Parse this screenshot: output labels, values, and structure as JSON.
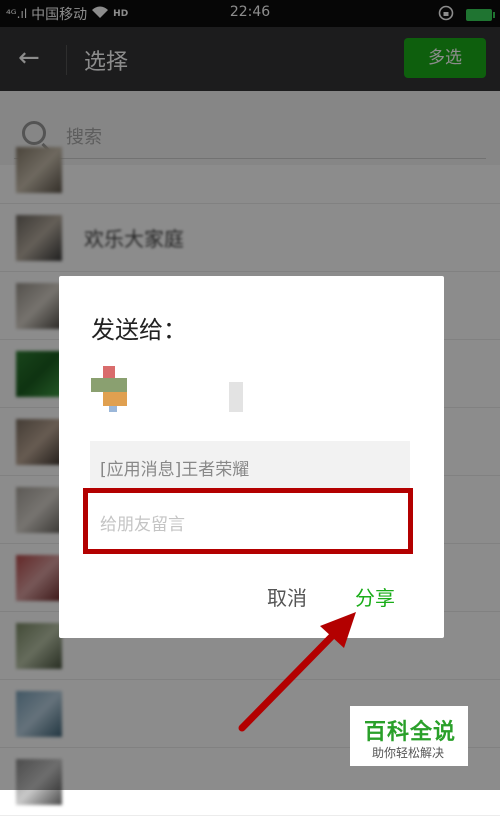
{
  "status_bar": {
    "signal": "⁴ᴳ.ıl",
    "carrier": "中国移动",
    "hd": "HD",
    "time": "22:46"
  },
  "header": {
    "back_icon": "←",
    "title": "选择",
    "multi_select_label": "多选"
  },
  "search": {
    "placeholder": "搜索"
  },
  "list": {
    "items": [
      {
        "name": "",
        "avatar_colors": [
          "#8a7f6e",
          "#c9bfae",
          "#5e564b"
        ]
      },
      {
        "name": "欢乐大家庭",
        "avatar_colors": [
          "#6f6a63",
          "#b7ada0",
          "#3a3a3a"
        ]
      },
      {
        "name": "",
        "avatar_colors": [
          "#9a948c",
          "#d7d1c8",
          "#4f4b45"
        ]
      },
      {
        "name": "",
        "avatar_colors": [
          "#2e7d32",
          "#1b5e20",
          "#43a047"
        ]
      },
      {
        "name": "",
        "avatar_colors": [
          "#7d6f62",
          "#bca795",
          "#3f3630"
        ]
      },
      {
        "name": "",
        "avatar_colors": [
          "#a8a39c",
          "#d8d3cc",
          "#6a6660"
        ]
      },
      {
        "name": "",
        "avatar_colors": [
          "#b64a4a",
          "#d9a0a0",
          "#6e2a2a"
        ]
      },
      {
        "name": "",
        "avatar_colors": [
          "#7b8a66",
          "#b9c4a8",
          "#4a5540"
        ]
      },
      {
        "name": "",
        "avatar_colors": [
          "#7aa0b8",
          "#b8d0e0",
          "#3f6478"
        ]
      },
      {
        "name": "",
        "avatar_colors": [
          "#8c8c8c",
          "#c8c8c8",
          "#4a4a4a"
        ]
      }
    ]
  },
  "dialog": {
    "title": "发送给：",
    "recipient_avatar_colors": [
      "#d96c6c",
      "#8aa070",
      "#e0a050"
    ],
    "message_preview": "[应用消息]王者荣耀",
    "input_placeholder": "给朋友留言",
    "cancel_label": "取消",
    "share_label": "分享"
  },
  "annotation_color": "#b30000",
  "watermark": {
    "title": "百科全说",
    "subtitle": "助你轻松解决"
  }
}
